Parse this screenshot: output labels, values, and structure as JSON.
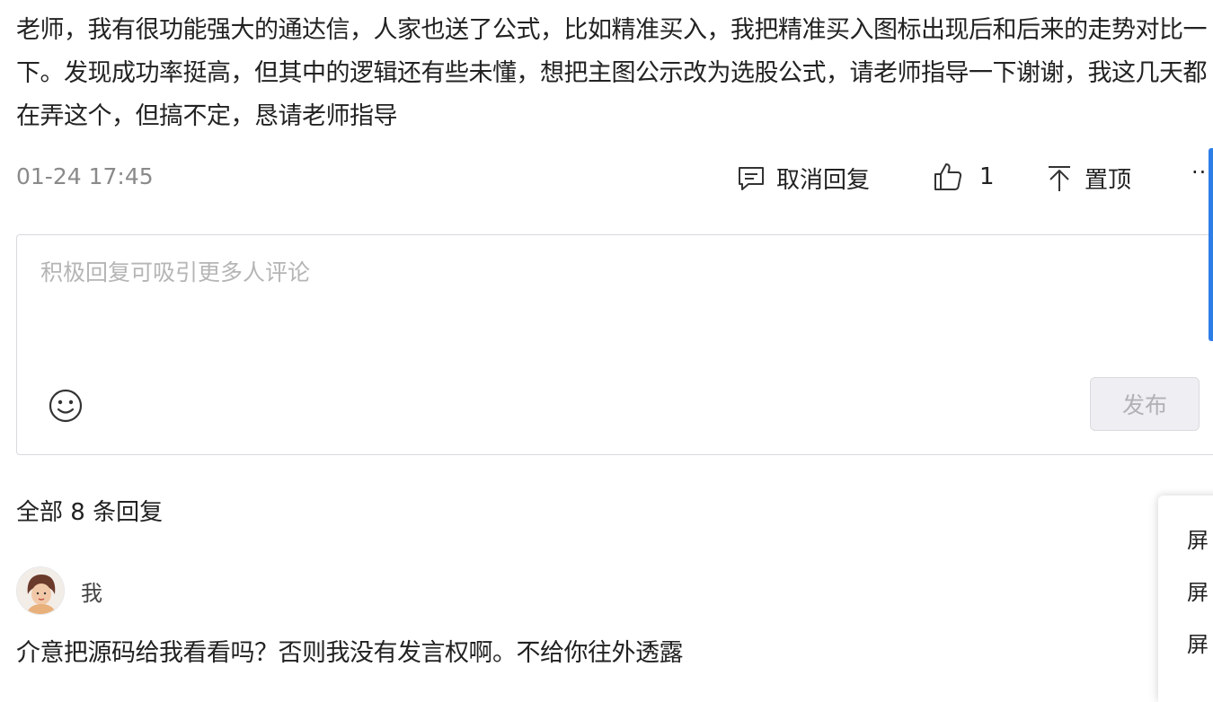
{
  "post": {
    "text": "老师，我有很功能强大的通达信，人家也送了公式，比如精准买入，我把精准买入图标出现后和后来的走势对比一下。发现成功率挺高，但其中的逻辑还有些未懂，想把主图公示改为选股公式，请老师指导一下谢谢，我这几天都在弄这个，但搞不定，恳请老师指导",
    "timestamp": "01-24 17:45"
  },
  "actions": {
    "reply_label": "取消回复",
    "like_count": "1",
    "pin_label": "置顶",
    "more_label": "··"
  },
  "reply_box": {
    "value": "",
    "placeholder": "积极回复可吸引更多人评论",
    "publish_label": "发布"
  },
  "replies": {
    "count_label": "全部 8 条回复"
  },
  "comment": {
    "username": "我",
    "text": "介意把源码给我看看吗？否则我没有发言权啊。不给你往外透露"
  },
  "side_menu": {
    "items": [
      "屏",
      "屏",
      "屏"
    ]
  },
  "colors": {
    "accent": "#2f7ee8",
    "muted_text": "#8a8a8a",
    "placeholder": "#b5b5b5"
  },
  "icons": [
    "comment-icon",
    "thumbs-up-icon",
    "pin-top-icon",
    "more-icon",
    "emoji-icon"
  ]
}
